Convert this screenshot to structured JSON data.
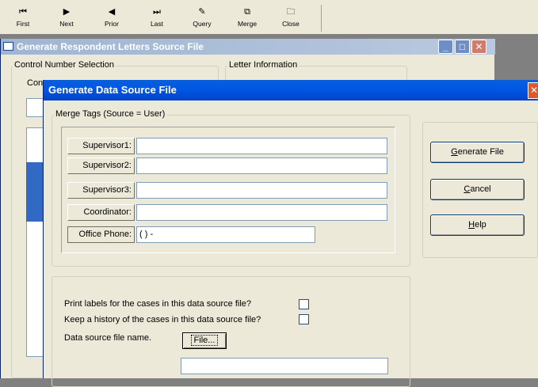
{
  "toolbar": {
    "buttons": [
      {
        "icon": "first-icon",
        "glyph": "⏮",
        "label": "First"
      },
      {
        "icon": "next-icon",
        "glyph": "▶",
        "label": "Next"
      },
      {
        "icon": "prior-icon",
        "glyph": "◀",
        "label": "Prior"
      },
      {
        "icon": "last-icon",
        "glyph": "⏭",
        "label": "Last"
      },
      {
        "icon": "query-icon",
        "glyph": "✎",
        "label": "Query"
      },
      {
        "icon": "merge-icon",
        "glyph": "⧉",
        "label": "Merge"
      },
      {
        "icon": "close-folder-icon",
        "glyph": "🗀",
        "label": "Close"
      }
    ]
  },
  "parent_window": {
    "title": "Generate Respondent Letters Source File",
    "group_control_number": "Control Number Selection",
    "group_letter_info": "Letter Information",
    "con_label_fragment": "Con",
    "caption_min": "_",
    "caption_max": "□",
    "caption_close": "✕"
  },
  "dialog": {
    "title": "Generate Data Source File",
    "close_glyph": "✕",
    "merge_tags_label": "Merge Tags (Source = User)",
    "fields": [
      {
        "label": "Supervisor1:",
        "value": ""
      },
      {
        "label": "Supervisor2:",
        "value": ""
      },
      {
        "label": "Supervisor3:",
        "value": ""
      },
      {
        "label": "Coordinator:",
        "value": ""
      },
      {
        "label": "Office Phone:",
        "value": "(  )    -"
      }
    ],
    "buttons": {
      "generate": {
        "mnemonic": "G",
        "rest": "enerate File"
      },
      "cancel": {
        "mnemonic": "C",
        "rest": "ancel"
      },
      "help": {
        "mnemonic": "H",
        "rest": "elp"
      }
    },
    "options": {
      "print_labels": "Print labels for the cases in this data source file?",
      "keep_history": "Keep a history of the cases in this data source file?",
      "data_source_name": "Data source file name.",
      "file_button": "File...",
      "file_name_value": ""
    }
  }
}
